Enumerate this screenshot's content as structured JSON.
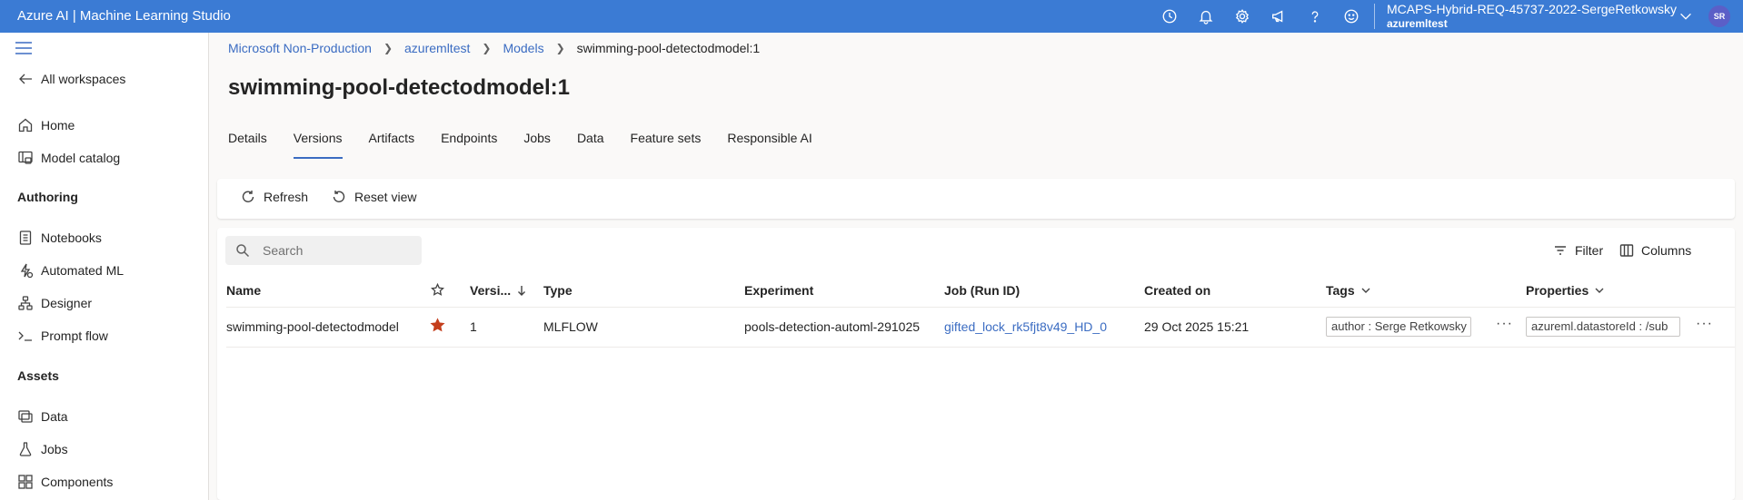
{
  "app": {
    "title": "Azure AI | Machine Learning Studio",
    "account_name": "MCAPS-Hybrid-REQ-45737-2022-SergeRetkowsky",
    "workspace_name": "azuremltest",
    "avatar_initials": "SR",
    "accent_color": "#3b7bd4"
  },
  "topbar_icons": [
    "history-icon",
    "bell-icon",
    "gear-icon",
    "megaphone-icon",
    "help-icon",
    "smiley-icon"
  ],
  "sidebar": {
    "back_label": "All workspaces",
    "items_top": [
      {
        "label": "Home",
        "icon": "home-icon"
      },
      {
        "label": "Model catalog",
        "icon": "model-catalog-icon"
      }
    ],
    "authoring_label": "Authoring",
    "authoring_items": [
      {
        "label": "Notebooks",
        "icon": "notebook-icon"
      },
      {
        "label": "Automated ML",
        "icon": "automl-icon"
      },
      {
        "label": "Designer",
        "icon": "designer-icon"
      },
      {
        "label": "Prompt flow",
        "icon": "prompt-flow-icon"
      }
    ],
    "assets_label": "Assets",
    "assets_items": [
      {
        "label": "Data",
        "icon": "data-icon"
      },
      {
        "label": "Jobs",
        "icon": "jobs-icon"
      },
      {
        "label": "Components",
        "icon": "components-icon"
      }
    ]
  },
  "breadcrumb": {
    "items": [
      "Microsoft Non-Production",
      "azuremltest",
      "Models"
    ],
    "current": "swimming-pool-detectodmodel:1"
  },
  "page": {
    "title": "swimming-pool-detectodmodel:1"
  },
  "tabs": [
    {
      "label": "Details",
      "active": false
    },
    {
      "label": "Versions",
      "active": true
    },
    {
      "label": "Artifacts",
      "active": false
    },
    {
      "label": "Endpoints",
      "active": false
    },
    {
      "label": "Jobs",
      "active": false
    },
    {
      "label": "Data",
      "active": false
    },
    {
      "label": "Feature sets",
      "active": false
    },
    {
      "label": "Responsible AI",
      "active": false
    }
  ],
  "toolbar": {
    "refresh_label": "Refresh",
    "reset_label": "Reset view"
  },
  "grid_tools": {
    "search_placeholder": "Search",
    "filter_label": "Filter",
    "columns_label": "Columns"
  },
  "table": {
    "columns": {
      "name": "Name",
      "version": "Versi...",
      "type": "Type",
      "experiment": "Experiment",
      "job": "Job (Run ID)",
      "created": "Created on",
      "tags": "Tags",
      "properties": "Properties"
    },
    "rows": [
      {
        "name": "swimming-pool-detectodmodel",
        "favorite": true,
        "version": "1",
        "type": "MLFLOW",
        "experiment": "pools-detection-automl-291025",
        "job": "gifted_lock_rk5fjt8v49_HD_0",
        "created": "29 Oct 2025 15:21",
        "tag": "author : Serge Retkowsky",
        "property": "azureml.datastoreId : /sub"
      }
    ]
  },
  "colors": {
    "favorite_star": "#c43e1c",
    "link": "#3b6cc2"
  }
}
